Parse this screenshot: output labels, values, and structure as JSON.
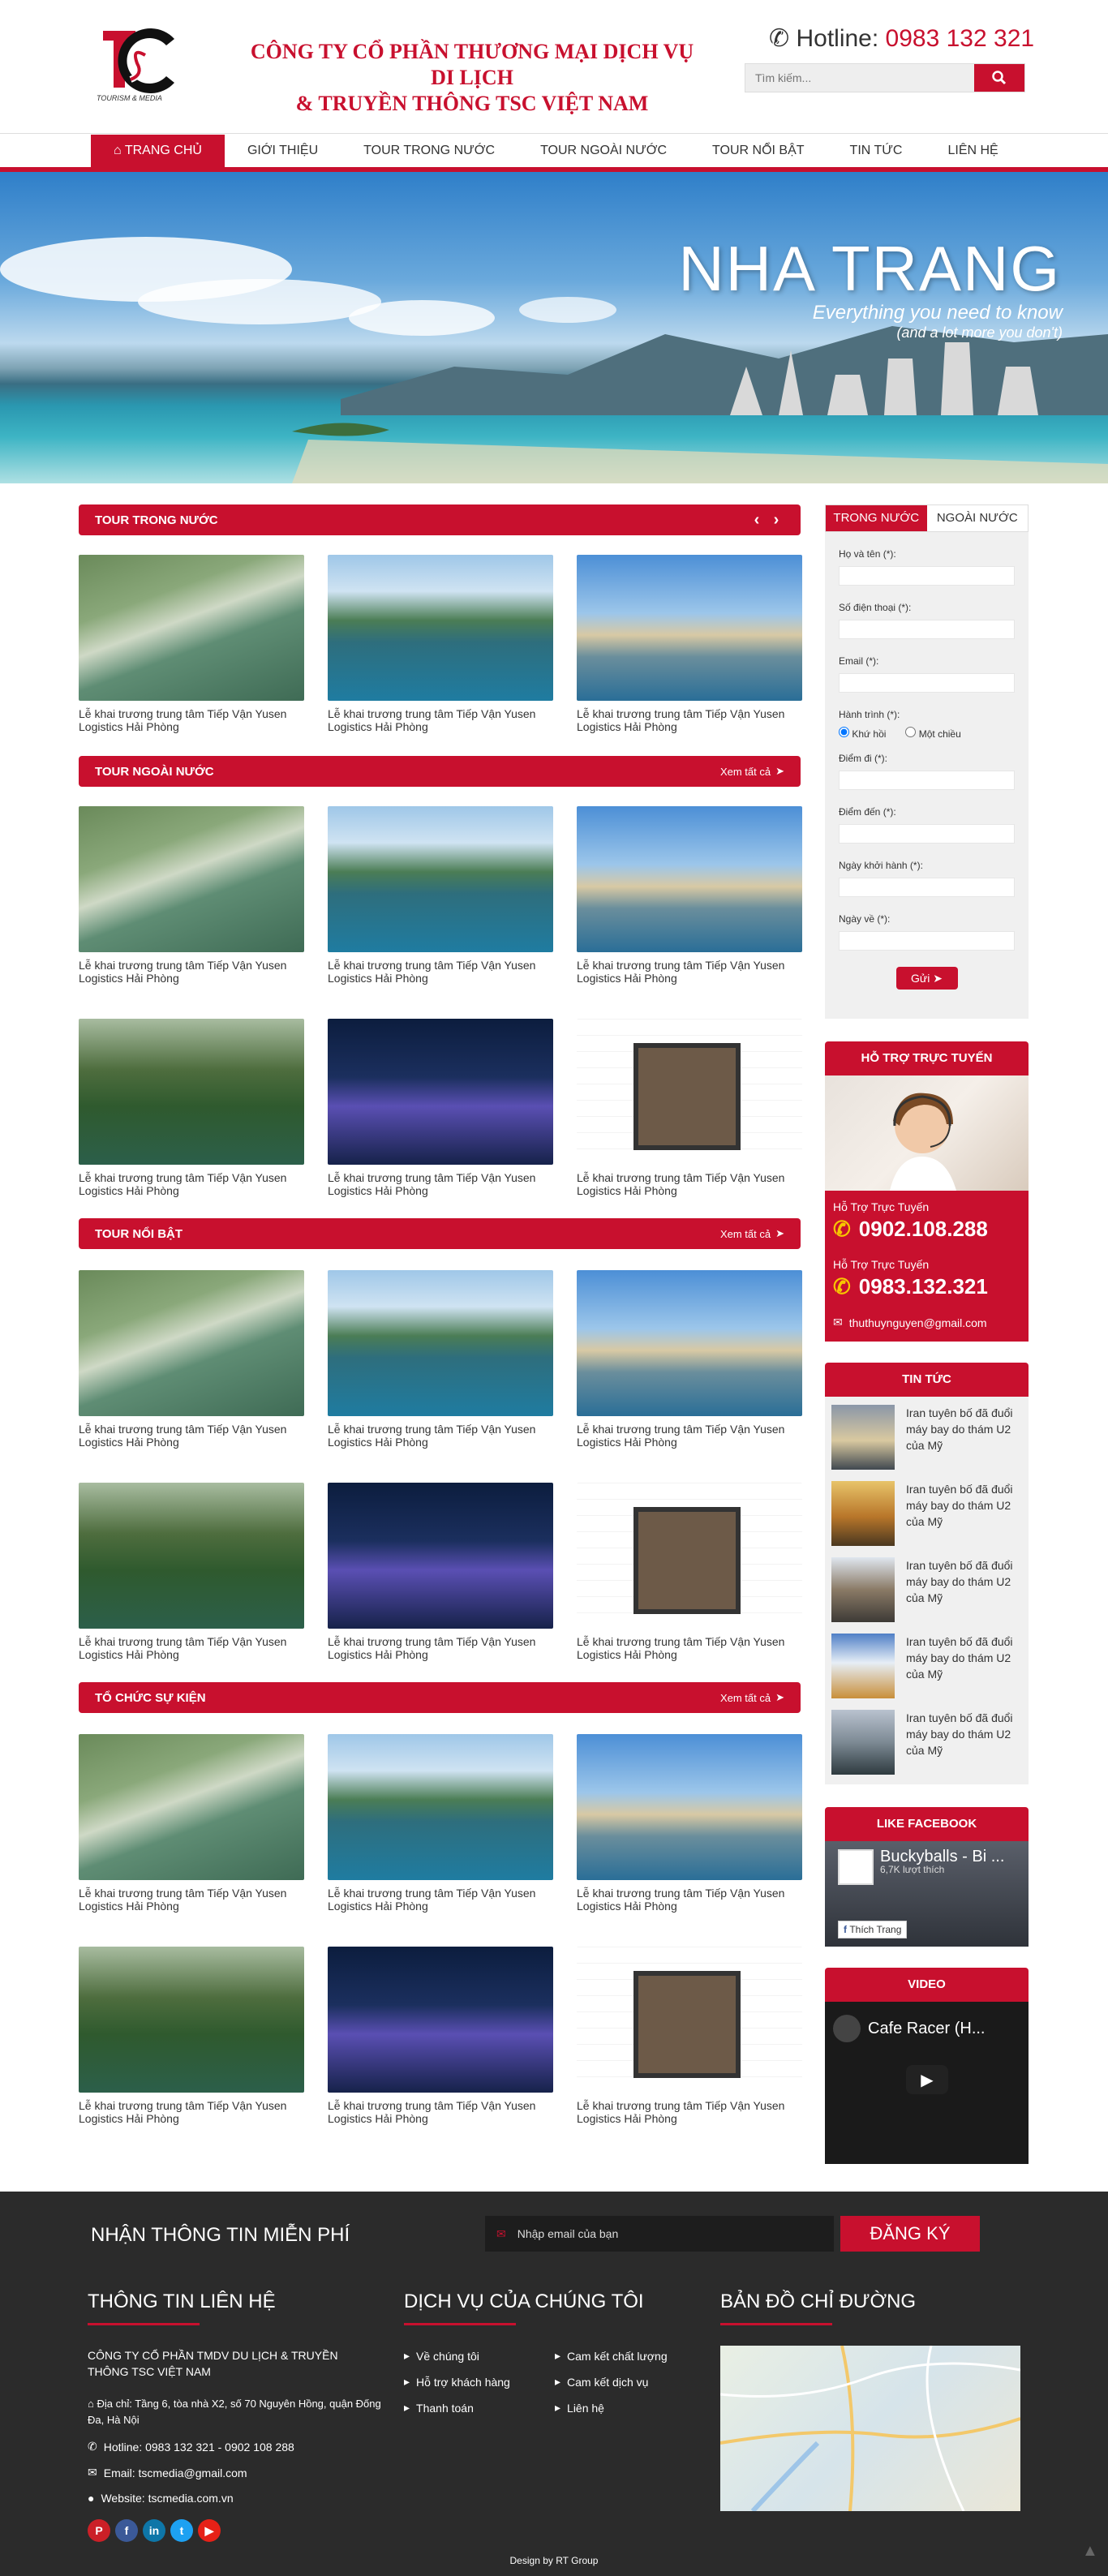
{
  "header": {
    "logo_text": "TSC",
    "logo_tagline": "TOURISM & MEDIA",
    "company_line1": "CÔNG TY CỔ PHẦN THƯƠNG MẠI DỊCH VỤ DI LỊCH",
    "company_line2": "& TRUYỀN THÔNG TSC VIỆT NAM",
    "hotline_label": "Hotline:",
    "hotline_number": "0983 132 321",
    "search_placeholder": "Tìm kiếm..."
  },
  "nav": [
    "TRANG CHỦ",
    "GIỚI THIỆU",
    "TOUR TRONG NƯỚC",
    "TOUR NGOÀI NƯỚC",
    "TOUR NỔI BẬT",
    "TIN TỨC",
    "LIÊN HỆ"
  ],
  "banner": {
    "title": "NHA TRANG",
    "subtitle": "Everything you need to know",
    "subtitle2": "(and a lot more you don't)"
  },
  "sections": {
    "domestic": "TOUR TRONG NƯỚC",
    "foreign": "TOUR NGOÀI NƯỚC",
    "featured": "TOUR NỔI BẬT",
    "events": "TỔ CHỨC SỰ KIỆN",
    "view_all": "Xem tất cả"
  },
  "tour_caption": "Lễ khai trương trung tâm Tiếp Vận Yusen Logistics Hải Phòng",
  "form": {
    "tab_domestic": "TRONG NƯỚC",
    "tab_foreign": "NGOÀI NƯỚC",
    "name": "Họ và tên (*):",
    "phone": "Số điện thoại (*):",
    "email": "Email (*):",
    "journey": "Hành trình (*):",
    "round_trip": "Khứ hồi",
    "one_way": "Một chiều",
    "from": "Điểm đi (*):",
    "to": "Điểm đến (*):",
    "depart": "Ngày khởi hành (*):",
    "return": "Ngày về (*):",
    "submit": "Gửi"
  },
  "support": {
    "title": "HỖ TRỢ TRỰC TUYẾN",
    "label": "Hỗ Trợ Trực Tuyến",
    "phone1": "0902.108.288",
    "phone2": "0983.132.321",
    "email": "thuthuynguyen@gmail.com"
  },
  "news": {
    "title": "TIN TỨC",
    "item": "Iran tuyên bố đã đuổi máy bay do thám U2 của Mỹ"
  },
  "facebook": {
    "title": "LIKE FACEBOOK",
    "page": "Buckyballs - Bi ...",
    "likes": "6,7K lượt thích",
    "like_btn": "Thích Trang"
  },
  "video": {
    "title": "VIDEO",
    "video_title": "Cafe Racer (H..."
  },
  "footer": {
    "newsletter": "NHẬN THÔNG TIN MIỄN PHÍ",
    "email_placeholder": "Nhập email của bạn",
    "register": "ĐĂNG KÝ",
    "contact_title": "THÔNG TIN LIÊN HỆ",
    "company1": "CÔNG TY CỔ PHẦN TMDV DU LỊCH & TRUYỀN",
    "company2": "THÔNG TSC VIỆT NAM",
    "address": "Địa chỉ: Tầng 6, tòa nhà X2, số 70 Nguyên Hồng, quận Đống Đa, Hà Nội",
    "hotline": "Hotline: 0983 132 321 - 0902 108 288",
    "email": "Email: tscmedia@gmail.com",
    "website": "Website: tscmedia.com.vn",
    "services_title": "DỊCH VỤ CỦA CHÚNG TÔI",
    "services_left": [
      "Về chúng tôi",
      "Hỗ trợ khách hàng",
      "Thanh toán"
    ],
    "services_right": [
      "Cam kết chất lượng",
      "Cam kết dịch vụ",
      "Liên hệ"
    ],
    "map_title": "BẢN ĐỒ CHỈ ĐƯỜNG",
    "design": "Design by RT Group"
  }
}
